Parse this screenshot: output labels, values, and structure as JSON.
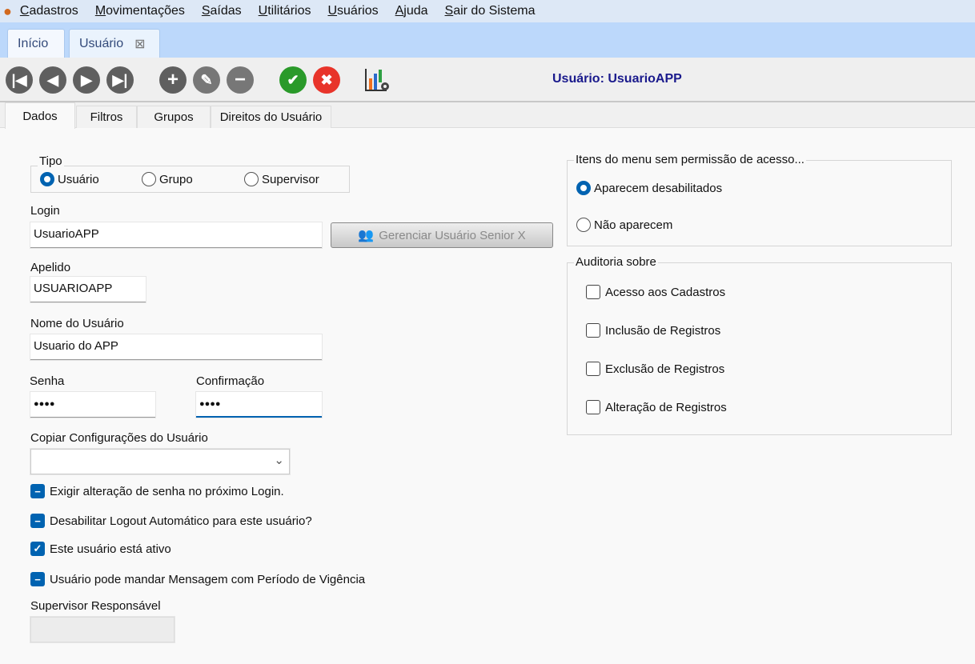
{
  "menu": [
    "Cadastros",
    "Movimentações",
    "Saídas",
    "Utilitários",
    "Usuários",
    "Ajuda",
    "Sair do Sistema"
  ],
  "doc_tabs": {
    "inicio": "Início",
    "usuario": "Usuário",
    "close": "⊠"
  },
  "toolbar": {
    "title": "Usuário:  UsuarioAPP",
    "icons": [
      "first",
      "prev",
      "next",
      "last",
      "add",
      "edit",
      "delete",
      "confirm",
      "cancel",
      "report-settings"
    ]
  },
  "sub_tabs": [
    "Dados",
    "Filtros",
    "Grupos",
    "Direitos do Usuário"
  ],
  "form": {
    "tipo": {
      "legend": "Tipo",
      "options": [
        "Usuário",
        "Grupo",
        "Supervisor"
      ],
      "selected": "Usuário"
    },
    "login_label": "Login",
    "login_value": "UsuarioAPP",
    "senior_button": "Gerenciar Usuário Senior X",
    "apelido_label": "Apelido",
    "apelido_value": "USUARIOAPP",
    "nome_label": "Nome do Usuário",
    "nome_value": "Usuario do APP",
    "senha_label": "Senha",
    "senha_value": "●●●●",
    "confirmacao_label": "Confirmação",
    "confirmacao_value": "●●●●",
    "copiar_label": "Copiar Configurações do Usuário",
    "copiar_value": "",
    "checks": [
      {
        "label": "Exigir alteração de senha no próximo Login.",
        "state": "indeterminate"
      },
      {
        "label": "Desabilitar Logout Automático para este usuário?",
        "state": "indeterminate"
      },
      {
        "label": "Este usuário está ativo",
        "state": "checked"
      },
      {
        "label": "Usuário pode mandar Mensagem com Período de Vigência",
        "state": "indeterminate"
      }
    ],
    "supervisor_label": "Supervisor Responsável",
    "supervisor_value": ""
  },
  "menu_perm": {
    "legend": "Itens do menu sem permissão de acesso...",
    "options": [
      "Aparecem desabilitados",
      "Não aparecem"
    ],
    "selected": "Aparecem desabilitados"
  },
  "auditoria": {
    "legend": "Auditoria sobre",
    "items": [
      "Acesso aos Cadastros",
      "Inclusão de Registros",
      "Exclusão de Registros",
      "Alteração de Registros"
    ]
  }
}
